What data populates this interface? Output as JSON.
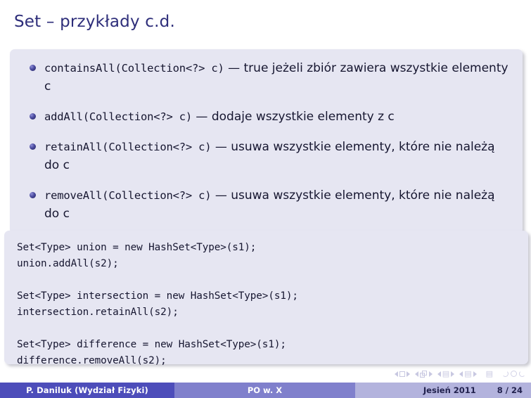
{
  "slide": {
    "title": "Set – przykłady c.d."
  },
  "bullets": [
    {
      "code": "containsAll(Collection<?> c)",
      "dash": " — ",
      "text": "true jeżeli zbiór zawiera wszystkie elementy c"
    },
    {
      "code": "addAll(Collection<?> c)",
      "dash": " — ",
      "text": "dodaje wszystkie elementy z c"
    },
    {
      "code": "retainAll(Collection<?> c)",
      "dash": " — ",
      "text": "usuwa wszystkie elementy, które nie należą do c"
    },
    {
      "code": "removeAll(Collection<?> c)",
      "dash": " — ",
      "text": "usuwa wszystkie elementy, które nie należą do c"
    }
  ],
  "code_block": {
    "content": "Set<Type> union = new HashSet<Type>(s1);\nunion.addAll(s2);\n\nSet<Type> intersection = new HashSet<Type>(s1);\nintersection.retainAll(s2);\n\nSet<Type> difference = new HashSet<Type>(s1);\ndifference.removeAll(s2);"
  },
  "nav_symbols": {
    "items": [
      "prev-frame-icon",
      "frame-icon",
      "next-frame-icon",
      "prev-subsection-icon",
      "subsection-icon",
      "next-subsection-icon",
      "prev-section-icon",
      "section-icon",
      "next-section-icon",
      "prev-part-icon",
      "part-icon",
      "next-part-icon",
      "presentation-icon",
      "back-icon",
      "search-icon",
      "forward-icon"
    ]
  },
  "footer": {
    "author": "P. Daniluk  (Wydział Fizyki)",
    "course": "PO w. X",
    "term": "Jesień 2011",
    "page": "8 / 24"
  },
  "colors": {
    "title": "#2e2e7a",
    "block_bg": "#e6e6f2",
    "footer_left": "#4d4dba",
    "footer_mid": "#8080cc",
    "footer_right": "#b3b3dd",
    "bullet": "#23235e"
  }
}
